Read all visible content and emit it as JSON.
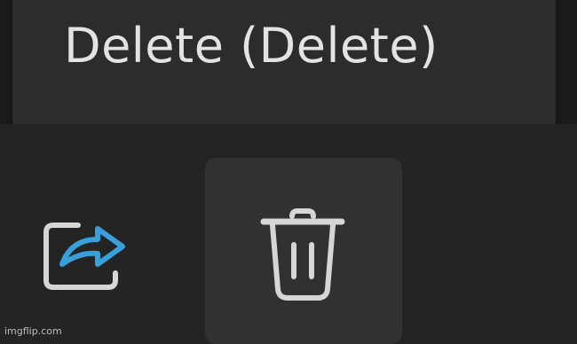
{
  "tooltip": {
    "text": "Delete (Delete)"
  },
  "toolbar": {
    "buttons": [
      {
        "name": "share",
        "icon": "share-icon",
        "accent": "#3aa0dc"
      },
      {
        "name": "delete",
        "icon": "trash-icon",
        "state": "hover"
      }
    ]
  },
  "watermark": {
    "text": "imgflip.com"
  },
  "colors": {
    "background": "#242424",
    "top_band": "#1c1c1c",
    "tooltip_bg": "#2c2c2c",
    "hover_bg": "#313131",
    "text": "#e3e3e3",
    "icon": "#d6d6d6",
    "accent": "#3aa0dc"
  }
}
